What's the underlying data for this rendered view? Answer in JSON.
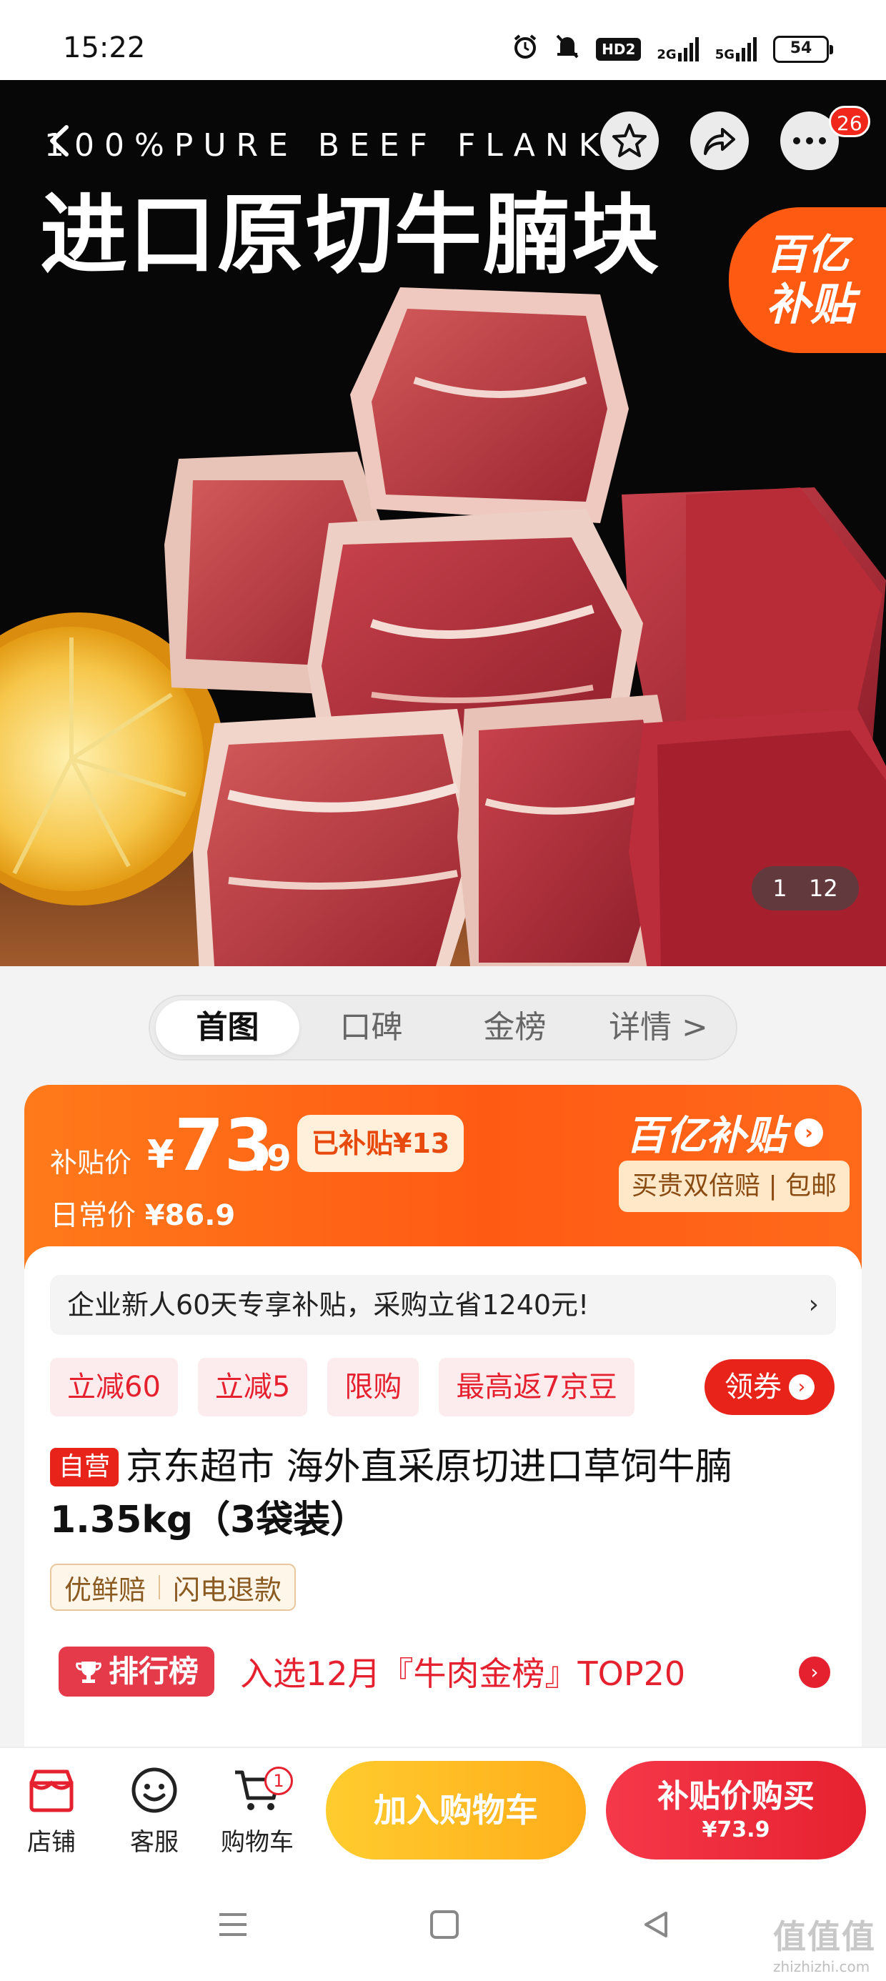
{
  "status_bar": {
    "time": "15:22",
    "network_1": "2G",
    "network_2": "5G",
    "hd": "HD2",
    "battery": "54"
  },
  "hero": {
    "subtitle": "100%PURE BEEF FLANK",
    "title": "进口原切牛腩块",
    "notification_count": "26",
    "subsidy_line1": "百亿",
    "subsidy_line2": "补贴",
    "counter_current": "1",
    "counter_total": "12"
  },
  "tabs": [
    "首图",
    "口碑",
    "金榜",
    "详情 >"
  ],
  "price": {
    "label": "补贴价",
    "currency": "¥",
    "integer": "73",
    "decimal": ".9",
    "saved": "已补贴¥13",
    "normal_label": "日常价",
    "normal_price": "¥86.9",
    "brand": "百亿补贴",
    "guarantee": "买贵双倍赔 | 包邮"
  },
  "info": {
    "promo_banner": "企业新人60天专享补贴，采购立省1240元!",
    "tags": [
      "立减60",
      "立减5",
      "限购",
      "最高返7京豆"
    ],
    "coupon_button": "领券",
    "self_operated": "自营",
    "title_line1": "京东超市 海外直采原切进口草饲牛腩",
    "title_line2": "1.35kg（3袋装）",
    "service_1": "优鲜赔",
    "service_2": "闪电退款",
    "rank_badge": "排行榜",
    "rank_text": "入选12月『牛肉金榜』TOP20"
  },
  "bottom_bar": {
    "shop": "店铺",
    "customer_service": "客服",
    "cart": "购物车",
    "cart_count": "1",
    "add_to_cart": "加入购物车",
    "buy_label": "补贴价购买",
    "buy_price": "¥73.9"
  },
  "watermark": {
    "logo": "值值值",
    "domain": "zhizhizhi.com"
  },
  "colors": {
    "accent_red": "#e6212f",
    "subsidy_orange": "#ff5a14",
    "add_cart_yellow": "#ffbc24"
  }
}
